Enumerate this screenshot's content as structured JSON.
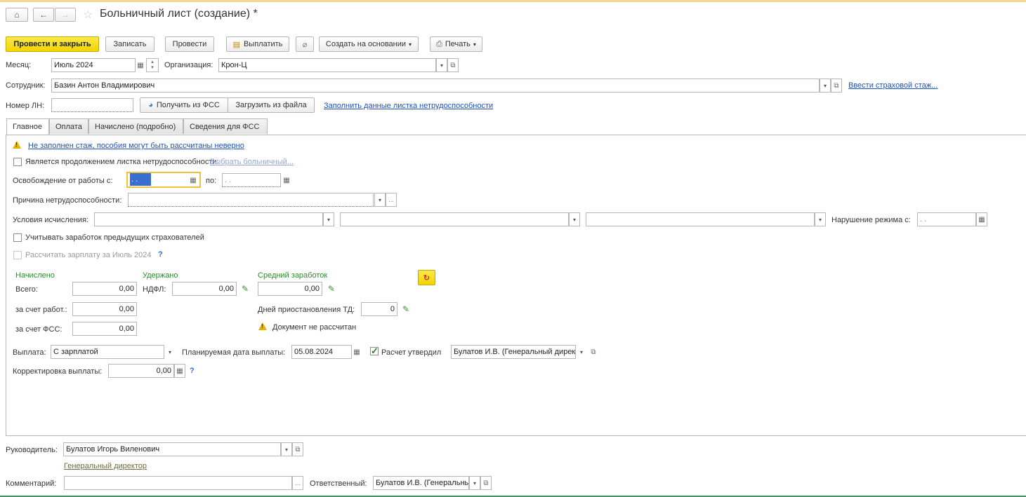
{
  "header": {
    "title": "Больничный лист (создание) *"
  },
  "toolbar": {
    "post_close": "Провести и закрыть",
    "save": "Записать",
    "post": "Провести",
    "pay": "Выплатить",
    "create_based": "Создать на основании",
    "print": "Печать"
  },
  "month": {
    "label": "Месяц:",
    "value": "Июль 2024"
  },
  "organization": {
    "label": "Организация:",
    "value": "Крон-Ц"
  },
  "employee": {
    "label": "Сотрудник:",
    "value": "Базин Антон Владимирович",
    "link": "Ввести страховой стаж..."
  },
  "ln_number": {
    "label": "Номер ЛН:",
    "value": "",
    "get_fss": "Получить из ФСС",
    "load_file": "Загрузить из файла",
    "fill_link": "Заполнить данные листка нетрудоспособности"
  },
  "tabs": [
    "Главное",
    "Оплата",
    "Начислено (подробно)",
    "Сведения для ФСС"
  ],
  "main": {
    "warning_link": "Не заполнен стаж, пособия могут быть рассчитаны неверно",
    "continuation_label": "Является продолжением листка нетрудоспособности:",
    "choose_sick_link": "Выбрать больничный...",
    "release_label": "Освобождение от работы с:",
    "release_from": ". .",
    "release_to_label": "по:",
    "release_to": ". .",
    "reason_label": "Причина нетрудоспособности:",
    "reason_value": "",
    "conditions_label": "Условия исчисления:",
    "violation_label": "Нарушение режима с:",
    "violation_value": ". .",
    "prev_insurers_label": "Учитывать заработок предыдущих страхователей",
    "calc_salary_label": "Рассчитать зарплату за Июль 2024",
    "accrued_header": "Начислено",
    "withheld_header": "Удержано",
    "avg_header": "Средний заработок",
    "total_label": "Всего:",
    "total_value": "0,00",
    "ndfl_label": "НДФЛ:",
    "ndfl_value": "0,00",
    "avg_value": "0,00",
    "employer_label": "за счет работ.:",
    "employer_value": "0,00",
    "fss_label": "за счет ФСС:",
    "fss_value": "0,00",
    "suspend_days_label": "Дней приостановления ТД:",
    "suspend_days_value": "0",
    "not_calculated": "Документ не рассчитан",
    "payment_label": "Выплата:",
    "payment_value": "С зарплатой",
    "planned_date_label": "Планируемая дата выплаты:",
    "planned_date_value": "05.08.2024",
    "approved_label": "Расчет утвердил",
    "approved_value": "Булатов И.В. (Генеральный дирек",
    "correction_label": "Корректировка выплаты:",
    "correction_value": "0,00"
  },
  "footer": {
    "head_label": "Руководитель:",
    "head_value": "Булатов Игорь Виленович",
    "head_position": "Генеральный директор",
    "comment_label": "Комментарий:",
    "comment_value": "",
    "responsible_label": "Ответственный:",
    "responsible_value": "Булатов И.В. (Генеральны"
  },
  "colors": {
    "primary_button": "#f2d400",
    "link": "#1f50b5",
    "section_header": "#2e8b2e",
    "warning": "#e2b400"
  }
}
